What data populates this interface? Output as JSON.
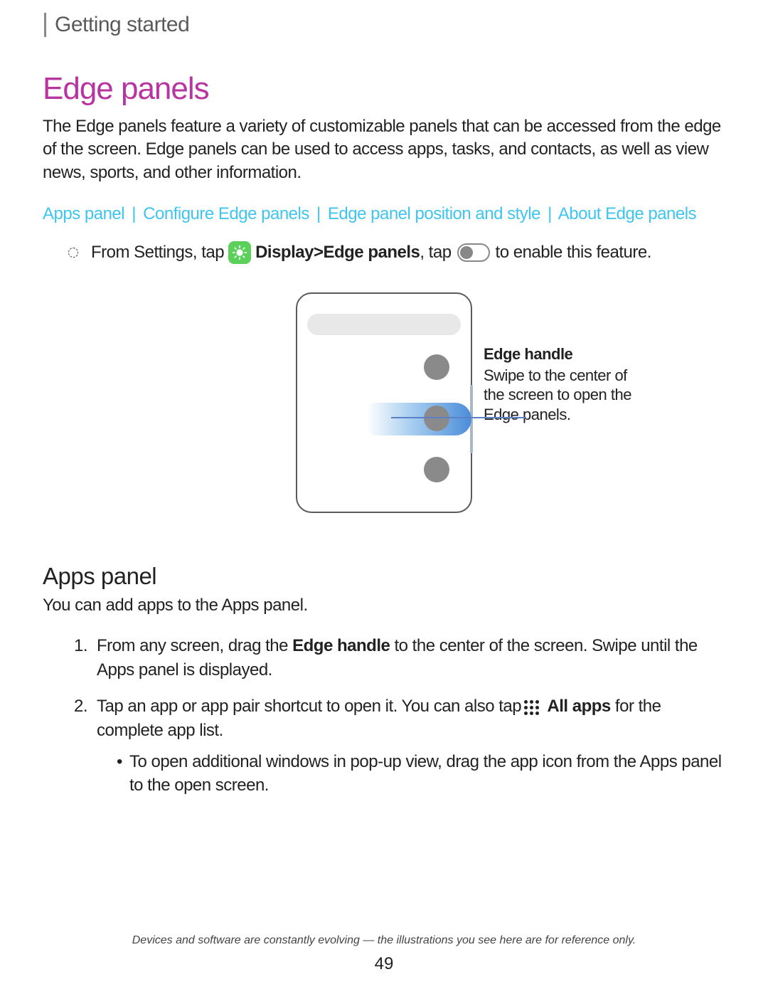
{
  "section_header": "Getting started",
  "title": "Edge panels",
  "intro": "The Edge panels feature a variety of customizable panels that can be accessed from the edge of the screen. Edge panels can be used to access apps, tasks, and contacts, as well as view news, sports, and other information.",
  "links": {
    "apps_panel": "Apps panel",
    "configure": "Configure Edge panels",
    "position": "Edge panel position and style",
    "about": "About Edge panels",
    "sep": "|"
  },
  "instruction": {
    "prefix": "From Settings, tap",
    "display": " Display ",
    "gt": ">",
    "edge_panels": " Edge panels",
    "mid": ", tap",
    "suffix": " to enable this feature."
  },
  "callout": {
    "title": "Edge handle",
    "text": "Swipe to the center of the screen to open the Edge panels."
  },
  "subsection": {
    "title": "Apps panel",
    "intro": "You can add apps to the Apps panel."
  },
  "steps": {
    "s1_num": "1.",
    "s1_a": "From any screen, drag the ",
    "s1_bold": "Edge handle",
    "s1_b": " to the center of the screen. Swipe until the Apps panel is displayed.",
    "s2_num": "2.",
    "s2_a": "Tap an app or app pair shortcut to open it. You can also tap",
    "s2_bold": " All apps",
    "s2_b": " for the complete app list.",
    "s2_sub_dot": "•",
    "s2_sub": "To open additional windows in pop-up view, drag the app icon from the Apps panel to the open screen."
  },
  "footer": {
    "note": "Devices and software are constantly evolving — the illustrations you see here are for reference only.",
    "page": "49"
  }
}
